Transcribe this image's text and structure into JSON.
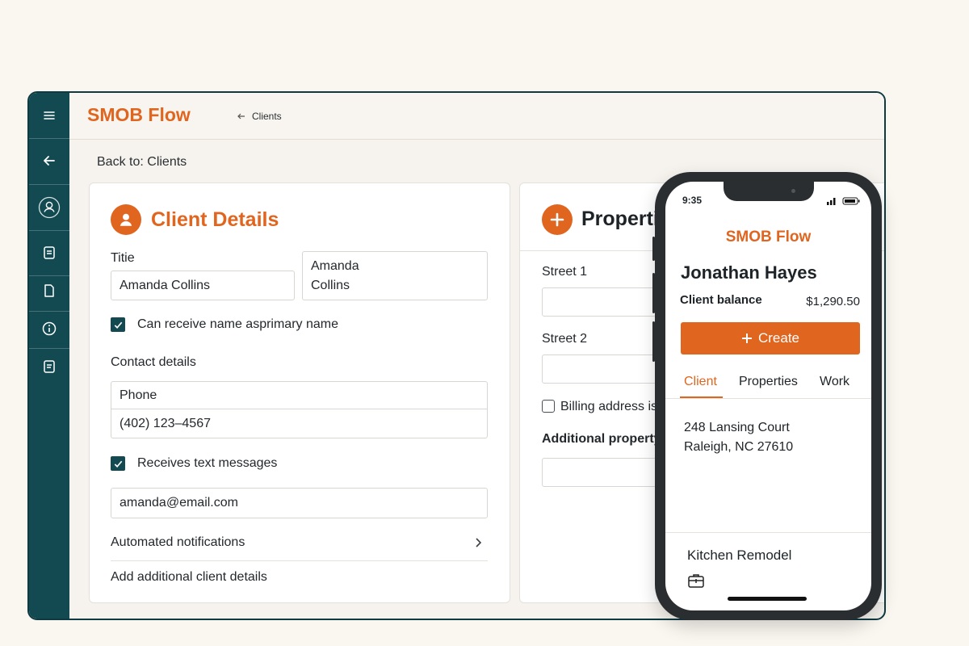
{
  "app": {
    "brand": "SMOB Flow",
    "breadcrumb": "Clients",
    "back_prefix": "Back to:",
    "back_target": "Clients"
  },
  "sidebar": {
    "items": [
      {
        "icon": "menu-icon"
      },
      {
        "icon": "back-arrow-icon"
      },
      {
        "icon": "user-icon"
      },
      {
        "icon": "document-icon"
      },
      {
        "icon": "page-icon"
      },
      {
        "icon": "info-icon"
      },
      {
        "icon": "notes-icon"
      }
    ]
  },
  "client_details": {
    "title": "Client Details",
    "title_label": "Titie",
    "name_value": "Amanda Collins",
    "name_split_line1": "Amanda",
    "name_split_line2": "Collins",
    "primary_checkbox_label": "Can receive name asprimary name",
    "contact_heading": "Contact details",
    "phone_label": "Phone",
    "phone_value": "(402) 123–4567",
    "text_checkbox_label": "Receives text messages",
    "email_value": "amanda@email.com",
    "notifications_label": "Automated notifications",
    "additional_label": "Add additional client details"
  },
  "properties": {
    "title": "Propertie",
    "street1_label": "Street 1",
    "street2_label": "Street 2",
    "billing_label": "Billing address is",
    "additional_label": "Additional property"
  },
  "mobile": {
    "time": "9:35",
    "brand": "SMOB Flow",
    "client_name": "Jonathan Hayes",
    "balance_label": "Client balance",
    "balance_value": "$1,290.50",
    "create_label": "Create",
    "tabs": [
      "Client",
      "Properties",
      "Work"
    ],
    "address_line1": "248 Lansing Court",
    "address_line2": "Raleigh, NC 27610",
    "job_title": "Kitchen Remodel"
  },
  "colors": {
    "accent": "#e0651f",
    "sidebar": "#134a52",
    "background": "#faf6f0"
  }
}
